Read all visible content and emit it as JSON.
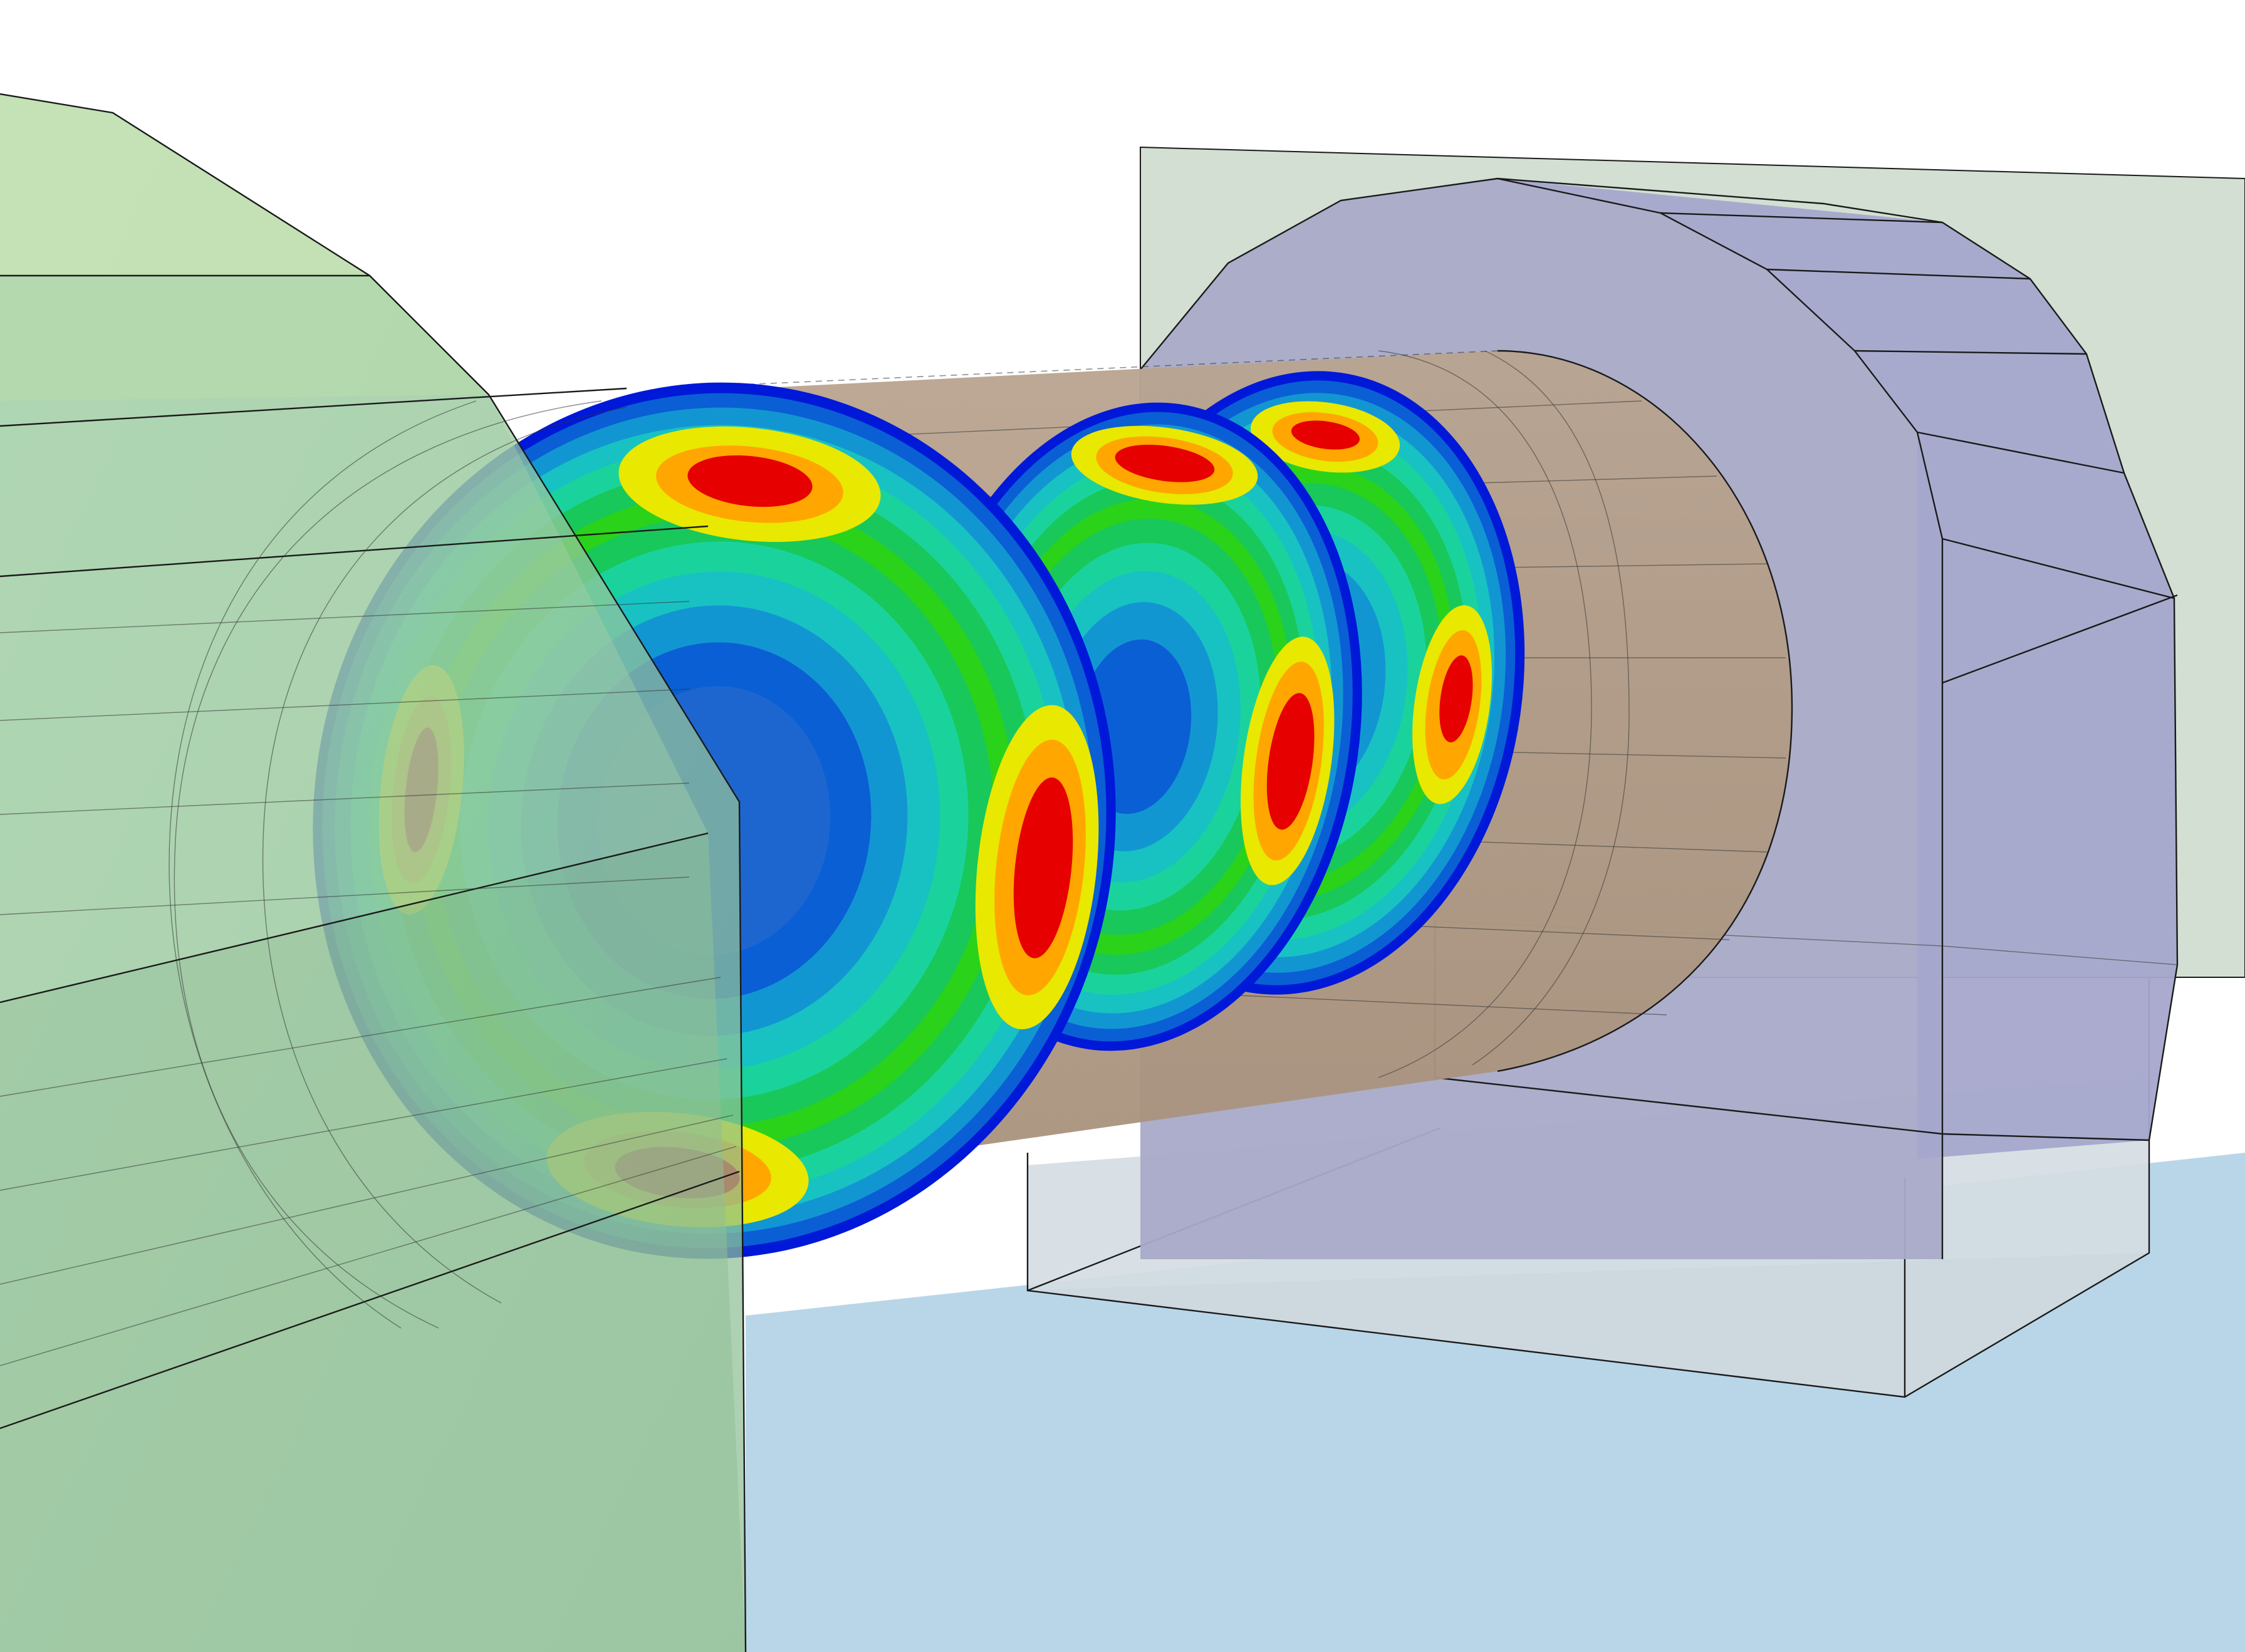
{
  "scene": {
    "background": "#ffffff",
    "colors": {
      "ground_block": "#b9d6e8",
      "left_soil_top": "#c4e1b4",
      "left_soil_face": "#9ccaa0",
      "left_soil_side": "#8fbf96",
      "right_back_wall": "#d2dfd2",
      "lining_front": "#a9aac8",
      "lining_top": "#b0b1c9",
      "lining_side": "#a4a6cc",
      "bored_tunnel": "#b4a08a",
      "low_box": "rgba(214,222,226,0.75)"
    },
    "contour_scale": [
      "#0018d8",
      "#0a5fd4",
      "#1296d2",
      "#18c2c2",
      "#1ad39c",
      "#18c85a",
      "#2ad21a",
      "#8ee010",
      "#e8e800",
      "#ffa600",
      "#ff5a00",
      "#e60000"
    ],
    "rings": [
      {
        "name": "front-ring"
      },
      {
        "name": "middle-ring"
      },
      {
        "name": "rear-ring"
      }
    ]
  }
}
